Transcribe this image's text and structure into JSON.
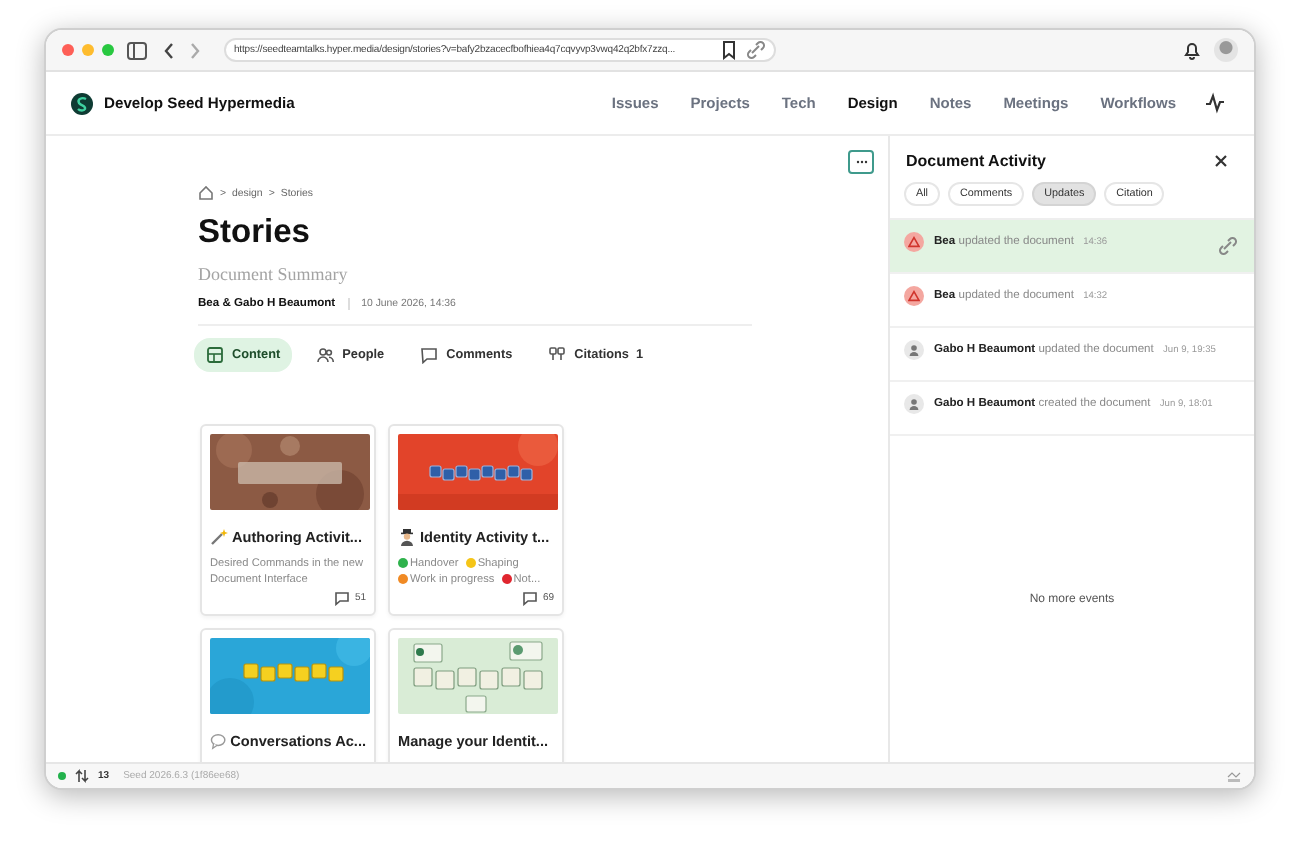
{
  "browser": {
    "url": "https://seedteamtalks.hyper.media/design/stories?v=bafy2bzacecfbofhiea4q7cqvyvp3vwq42q2bfx7zzq..."
  },
  "site": {
    "title": "Develop Seed Hypermedia",
    "nav": [
      {
        "label": "Issues",
        "selected": false
      },
      {
        "label": "Projects",
        "selected": false
      },
      {
        "label": "Tech",
        "selected": false
      },
      {
        "label": "Design",
        "selected": true
      },
      {
        "label": "Notes",
        "selected": false
      },
      {
        "label": "Meetings",
        "selected": false
      },
      {
        "label": "Workflows",
        "selected": false
      }
    ]
  },
  "document": {
    "breadcrumb": [
      {
        "separator": ">",
        "label": "design"
      },
      {
        "separator": ">",
        "label": "Stories"
      }
    ],
    "title": "Stories",
    "summary": "Document Summary",
    "authors": "Bea & Gabo H Beaumont",
    "date": "10 June 2026, 14:36",
    "tabs": [
      {
        "kind": "content",
        "label": "Content",
        "selected": true
      },
      {
        "kind": "people",
        "label": "People",
        "selected": false
      },
      {
        "kind": "comments",
        "label": "Comments",
        "selected": false
      },
      {
        "kind": "citations",
        "label": "Citations",
        "count": "1",
        "selected": false
      }
    ],
    "cards": [
      {
        "title": "Authoring Activit...",
        "description": "Desired Commands in the new Document Interface",
        "comments": "51"
      },
      {
        "title": "Identity Activity t...",
        "statuses": [
          {
            "label": "Handover",
            "color": "#2fb24c"
          },
          {
            "label": "Shaping",
            "color": "#f5c518"
          },
          {
            "label": "Work in progress",
            "color": "#f08a24"
          },
          {
            "label": "Not...",
            "color": "#e0262f"
          }
        ],
        "comments": "69"
      },
      {
        "title": "Conversations Ac..."
      },
      {
        "title": "Manage your Identit..."
      }
    ]
  },
  "activity": {
    "title": "Document Activity",
    "filters": [
      {
        "label": "All",
        "selected": false
      },
      {
        "label": "Comments",
        "selected": false
      },
      {
        "label": "Updates",
        "selected": true
      },
      {
        "label": "Citation",
        "selected": false
      }
    ],
    "events": [
      {
        "kind": "alert",
        "author": "Bea",
        "action": "updated the document",
        "time": "14:36",
        "selected": true
      },
      {
        "kind": "alert",
        "author": "Bea",
        "action": "updated the document",
        "time": "14:32",
        "selected": false
      },
      {
        "kind": "person",
        "author": "Gabo H Beaumont",
        "action": "updated the document",
        "time": "Jun 9, 19:35",
        "selected": false
      },
      {
        "kind": "person",
        "author": "Gabo H Beaumont",
        "action": "created the document",
        "time": "Jun 9, 18:01",
        "selected": false
      }
    ],
    "empty": "No more events"
  },
  "status_bar": {
    "online": true,
    "peers": "13",
    "version": "Seed 2026.6.3 (1f86ee68)"
  }
}
